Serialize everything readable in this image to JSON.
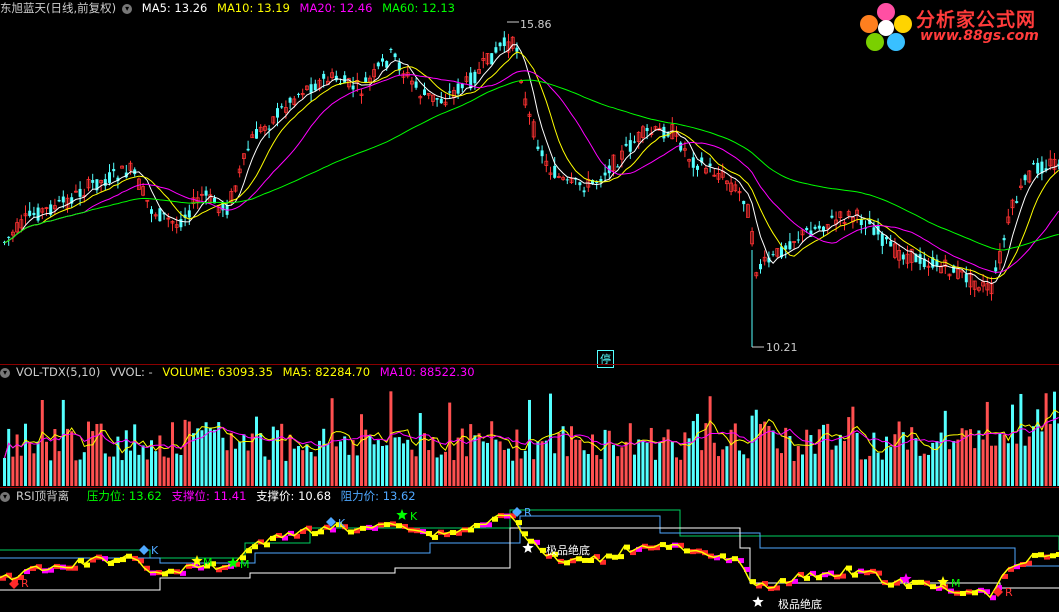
{
  "main_header": {
    "stock_title": "东旭蓝天(日线,前复权)",
    "ma5": "MA5: 13.26",
    "ma10": "MA10: 13.19",
    "ma20": "MA20: 12.46",
    "ma60": "MA60: 12.13"
  },
  "logo": {
    "title": "分析家公式网",
    "url": "www.88gs.com"
  },
  "main_annotations": {
    "high": "15.86",
    "low": "10.21",
    "halt": "停"
  },
  "vol_header": {
    "name": "VOL-TDX(5,10)",
    "vvol": "VVOL: -",
    "volume": "VOLUME: 63093.35",
    "ma5": "MA5: 82284.70",
    "ma10": "MA10: 88522.30"
  },
  "rsi_header": {
    "name": "RSI顶背离",
    "pressure": "压力位: 13.62",
    "support": "支撑位: 11.41",
    "support_price": "支撑价: 10.68",
    "resistance": "阻力价: 13.62"
  },
  "rsi_markers": {
    "extreme_bottom_1": "极品绝底",
    "extreme_bottom_2": "极品绝底",
    "k": "K",
    "m": "M",
    "r": "R"
  },
  "colors": {
    "ma5": "#ffffff",
    "ma10": "#ffff00",
    "ma20": "#ff00ff",
    "ma60": "#00ff00",
    "up": "#ff3232",
    "down": "#54ffff",
    "separator": "#8b0000"
  }
}
